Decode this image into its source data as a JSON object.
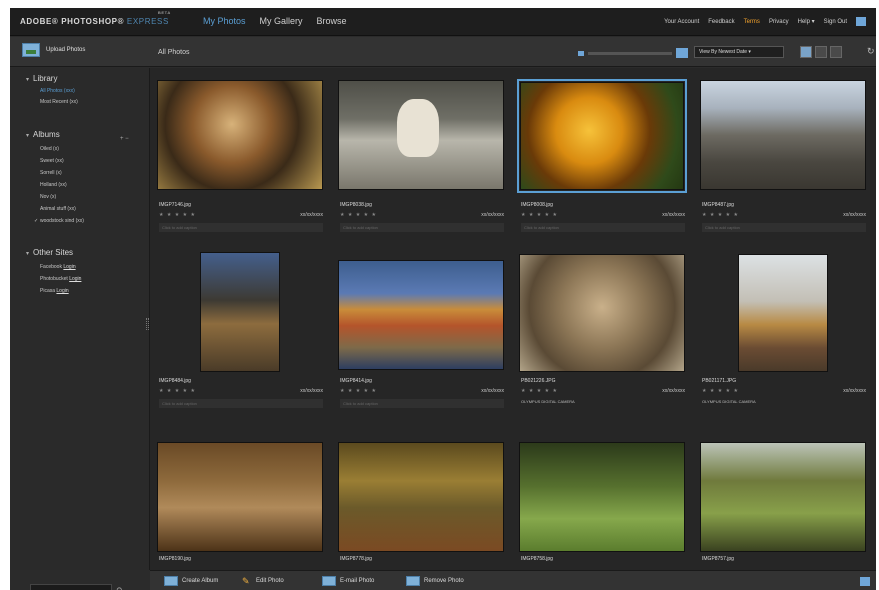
{
  "app": {
    "brand_main": "ADOBE® PHOTOSHOP®",
    "brand_sub": "EXPRESS",
    "brand_tag": "BETA"
  },
  "nav": {
    "items": [
      "My Photos",
      "My Gallery",
      "Browse"
    ],
    "active": "My Photos"
  },
  "top_links": {
    "account": "Your Account",
    "feedback": "Feedback",
    "terms": "Terms",
    "privacy": "Privacy",
    "help": "Help ▾",
    "signout": "Sign Out"
  },
  "toolbar": {
    "upload": "Upload Photos",
    "section_title": "All Photos",
    "sort": "View By Newest Date ▾"
  },
  "sidebar": {
    "library": {
      "title": "Library",
      "items": [
        "All Photos (xxx)",
        "Most Recent (xx)"
      ]
    },
    "albums": {
      "title": "Albums",
      "controls": "+ −",
      "items": [
        "Oiled (x)",
        "Sweet (xx)",
        "Sorrell (x)",
        "Holland (xx)",
        "Nov (x)",
        "Animal stuff (xx)",
        "woodstock sind (xx)"
      ]
    },
    "other_sites": {
      "title": "Other Sites",
      "items": [
        {
          "prefix": "Facebook ",
          "link": "Login"
        },
        {
          "prefix": "Photobucket ",
          "link": "Login"
        },
        {
          "prefix": "Picasa ",
          "link": "Login"
        }
      ]
    }
  },
  "photos": [
    {
      "name": "IMGP7146.jpg",
      "date": "xx/xx/xxxx",
      "caption": "Click to add caption",
      "camera": "",
      "stars": "★ ★ ★ ★ ★"
    },
    {
      "name": "IMGP8038.jpg",
      "date": "xx/xx/xxxx",
      "caption": "Click to add caption",
      "camera": "",
      "stars": "★ ★ ★ ★ ★"
    },
    {
      "name": "IMGP8008.jpg",
      "date": "xx/xx/xxxx",
      "caption": "Click to add caption",
      "camera": "",
      "stars": "★ ★ ★ ★ ★"
    },
    {
      "name": "IMGP8487.jpg",
      "date": "xx/xx/xxxx",
      "caption": "Click to add caption",
      "camera": "",
      "stars": "★ ★ ★ ★ ★"
    },
    {
      "name": "IMGP8484.jpg",
      "date": "xx/xx/xxxx",
      "caption": "Click to add caption",
      "camera": "",
      "stars": "★ ★ ★ ★ ★"
    },
    {
      "name": "IMGP8414.jpg",
      "date": "xx/xx/xxxx",
      "caption": "Click to add caption",
      "camera": "",
      "stars": "★ ★ ★ ★ ★"
    },
    {
      "name": "PB021226.JPG",
      "date": "xx/xx/xxxx",
      "caption": "",
      "camera": "OLYMPUS DIGITAL CAMERA",
      "stars": "★ ★ ★ ★ ★"
    },
    {
      "name": "PB021171.JPG",
      "date": "xx/xx/xxxx",
      "caption": "",
      "camera": "OLYMPUS DIGITAL CAMERA",
      "stars": "★ ★ ★ ★ ★"
    },
    {
      "name": "IMGP8190.jpg",
      "date": "",
      "caption": "",
      "camera": "",
      "stars": ""
    },
    {
      "name": "IMGP8778.jpg",
      "date": "",
      "caption": "",
      "camera": "",
      "stars": ""
    },
    {
      "name": "IMGP8758.jpg",
      "date": "",
      "caption": "",
      "camera": "",
      "stars": ""
    },
    {
      "name": "IMGP8757.jpg",
      "date": "",
      "caption": "",
      "camera": "",
      "stars": ""
    }
  ],
  "bottom": {
    "create": "Create Album",
    "edit": "Edit Photo",
    "email": "E-mail Photo",
    "remove": "Remove Photo"
  },
  "colors": {
    "accent_blue": "#5b9fd4",
    "terms_orange": "#f0a02c",
    "background": "#2b2b2b"
  }
}
